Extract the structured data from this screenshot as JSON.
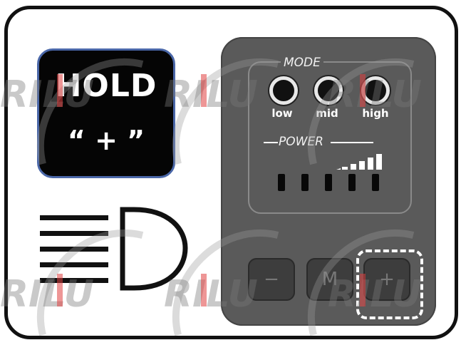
{
  "instruction": {
    "hold_text": "HOLD",
    "key_text": "“ + ”"
  },
  "device": {
    "mode_label": "MODE",
    "power_label": "POWER",
    "led_labels": [
      "low",
      "mid",
      "high"
    ],
    "power_bar_count": 5,
    "keys": [
      "−",
      "M",
      "+"
    ]
  },
  "icons": {
    "headlight": "high-beam-headlight-icon",
    "signal": "signal-strength-icon"
  },
  "watermark_text": "RILU",
  "colors": {
    "hold_border": "#4a67a8",
    "watermark_red": "#e04040",
    "device_body": "#5a5a5a"
  }
}
